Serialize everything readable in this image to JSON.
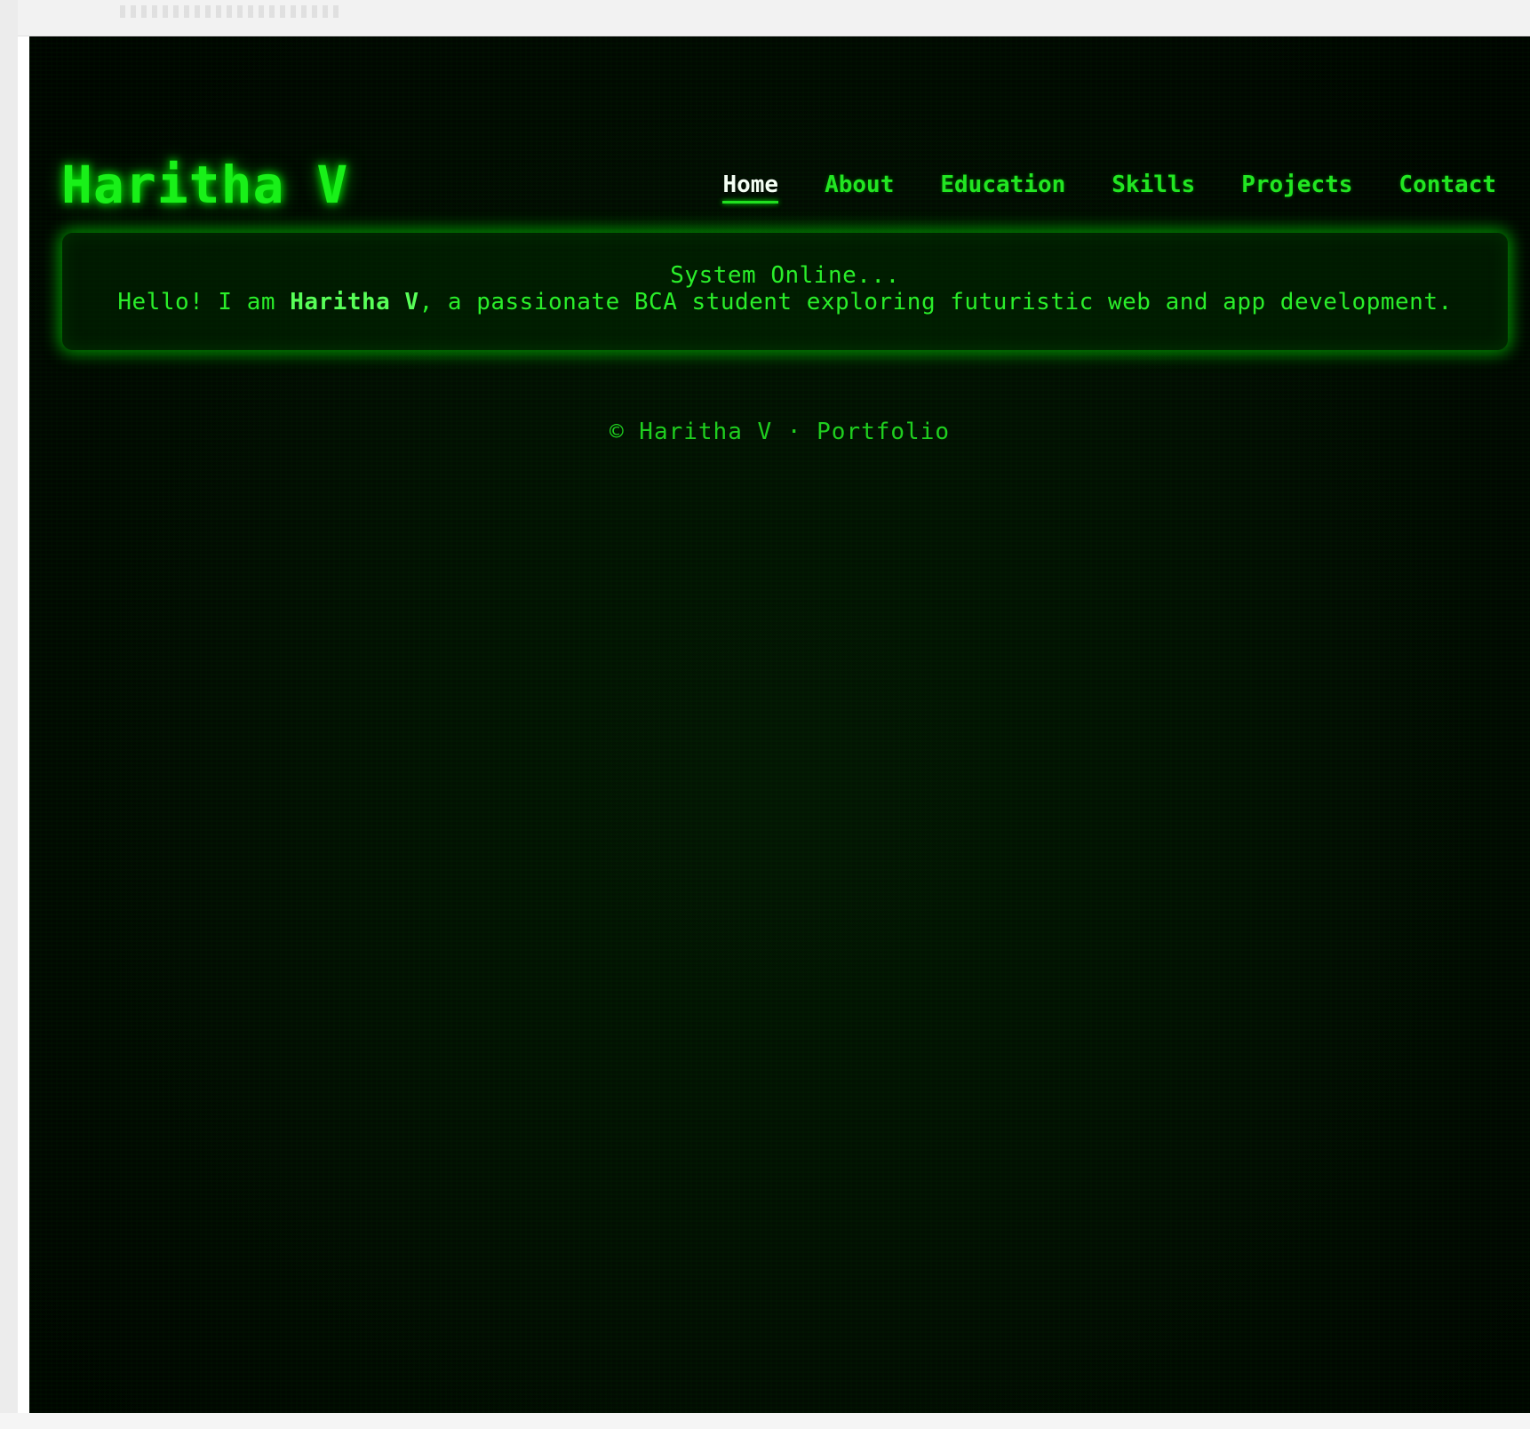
{
  "brand": {
    "name": "Haritha V"
  },
  "nav": {
    "items": [
      {
        "label": "Home",
        "active": true
      },
      {
        "label": "About",
        "active": false
      },
      {
        "label": "Education",
        "active": false
      },
      {
        "label": "Skills",
        "active": false
      },
      {
        "label": "Projects",
        "active": false
      },
      {
        "label": "Contact",
        "active": false
      }
    ]
  },
  "hero": {
    "status_text": "System Online...",
    "intro_prefix": "Hello! I am ",
    "intro_name": "Haritha V",
    "intro_suffix": ", a passionate BCA student exploring futuristic web and app development."
  },
  "footer": {
    "text": "© Haritha V · Portfolio"
  },
  "colors": {
    "accent_green": "#19f019",
    "background": "#010801",
    "active_nav": "#f4fff4"
  }
}
